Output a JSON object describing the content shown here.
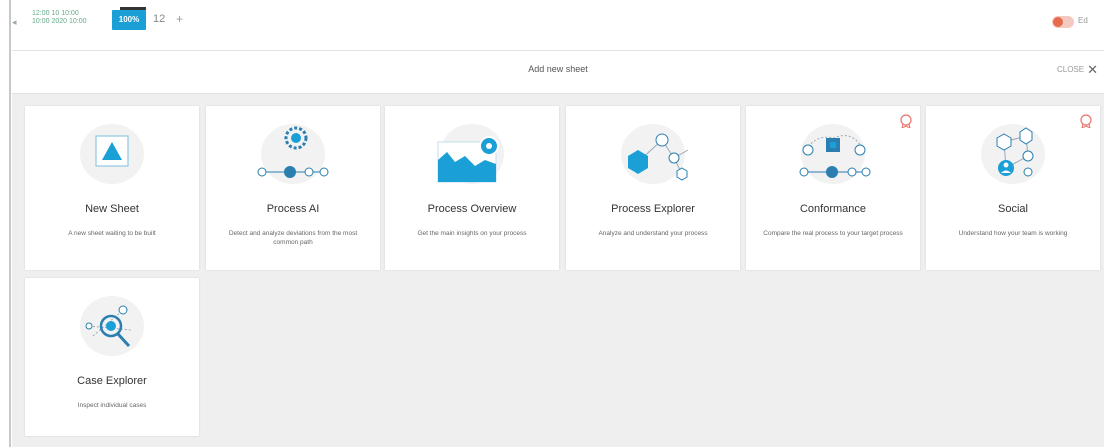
{
  "topbar": {
    "collapse_icon": "chevron-left-icon",
    "date_from": "12:00 10 10:00",
    "date_to": "10:00 2020 10:00",
    "zoom": "100%",
    "sheet_count": "12",
    "add": "+",
    "toggle_label": "Ed"
  },
  "header": {
    "title": "Add new sheet",
    "close_label": "CLOSE",
    "close_icon": "close-icon"
  },
  "cards": [
    {
      "title": "New Sheet",
      "desc": "A new sheet waiting to be built",
      "icon": "new-sheet-icon"
    },
    {
      "title": "Process AI",
      "desc": "Detect and analyze deviations from the most common path",
      "icon": "process-ai-icon"
    },
    {
      "title": "Process Overview",
      "desc": "Get the main insights on your process",
      "icon": "process-overview-icon"
    },
    {
      "title": "Process Explorer",
      "desc": "Analyze and understand your process",
      "icon": "process-explorer-icon"
    },
    {
      "title": "Conformance",
      "desc": "Compare the real process to your target process",
      "icon": "conformance-icon"
    },
    {
      "title": "Social",
      "desc": "Understand how your team is working",
      "icon": "social-icon"
    },
    {
      "title": "Case Explorer",
      "desc": "Inspect individual cases",
      "icon": "case-explorer-icon"
    }
  ],
  "colors": {
    "accent": "#1a9fd6",
    "dark_accent": "#2a7fb0",
    "badge": "#e8736b"
  }
}
